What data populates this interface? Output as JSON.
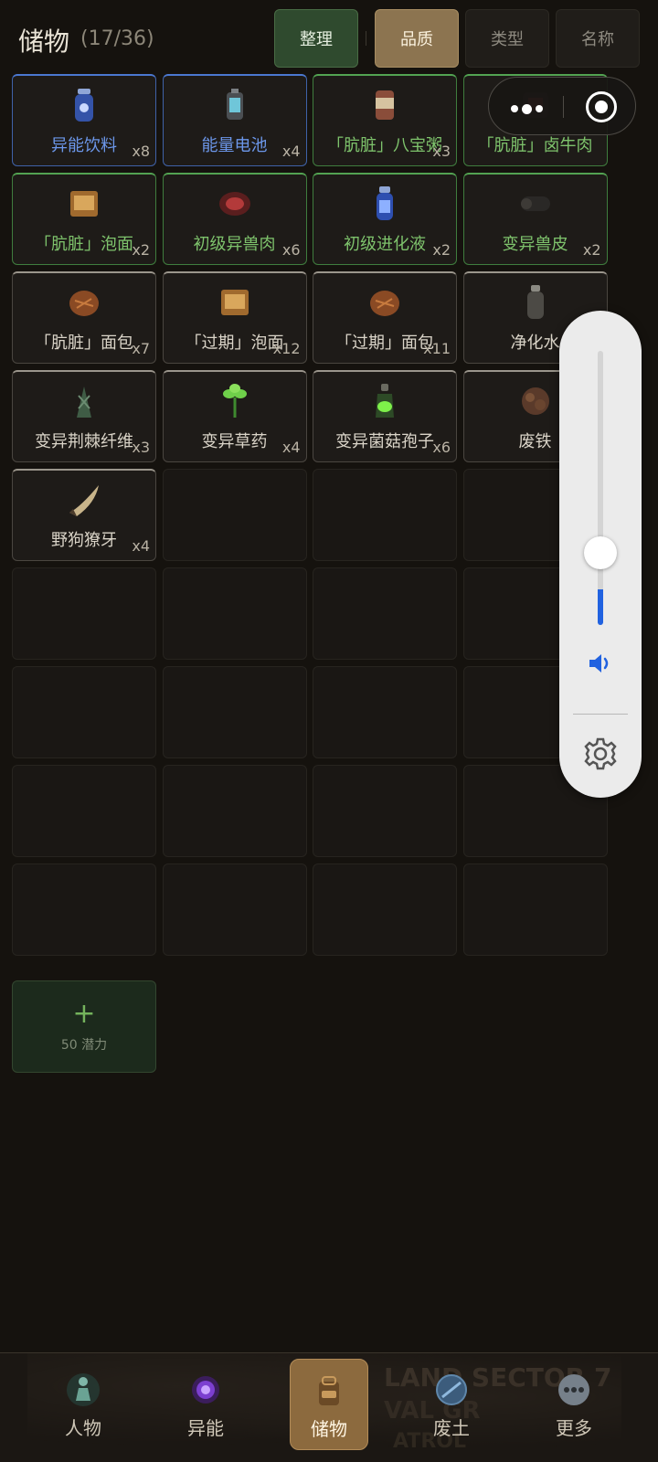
{
  "header": {
    "title": "储物",
    "count": "(17/36)",
    "organize_button": "整理",
    "sort_tabs": [
      "品质",
      "类型",
      "名称"
    ],
    "active_sort": "品质"
  },
  "items": [
    {
      "name": "异能饮料",
      "qty": "x8",
      "rarity": "blue",
      "icon": "drink-bottle-icon"
    },
    {
      "name": "能量电池",
      "qty": "x4",
      "rarity": "blue",
      "icon": "battery-icon"
    },
    {
      "name": "「肮脏」八宝粥",
      "qty": "x3",
      "rarity": "green",
      "icon": "can-icon"
    },
    {
      "name": "「肮脏」卤牛肉",
      "qty": "",
      "rarity": "green",
      "icon": "meat-can-icon"
    },
    {
      "name": "「肮脏」泡面",
      "qty": "x2",
      "rarity": "green",
      "icon": "noodle-pack-icon"
    },
    {
      "name": "初级异兽肉",
      "qty": "x6",
      "rarity": "green",
      "icon": "beast-meat-icon"
    },
    {
      "name": "初级进化液",
      "qty": "x2",
      "rarity": "green",
      "icon": "evolution-liquid-icon"
    },
    {
      "name": "变异兽皮",
      "qty": "x2",
      "rarity": "green",
      "icon": "hide-roll-icon"
    },
    {
      "name": "「肮脏」面包",
      "qty": "x7",
      "rarity": "white",
      "icon": "bread-icon"
    },
    {
      "name": "「过期」泡面",
      "qty": "x12",
      "rarity": "white",
      "icon": "noodle-pack-icon"
    },
    {
      "name": "「过期」面包",
      "qty": "x11",
      "rarity": "white",
      "icon": "bread-icon"
    },
    {
      "name": "净化水",
      "qty": "",
      "rarity": "white",
      "icon": "water-bottle-icon"
    },
    {
      "name": "变异荆棘纤维",
      "qty": "x3",
      "rarity": "white",
      "icon": "thorn-fiber-icon"
    },
    {
      "name": "变异草药",
      "qty": "x4",
      "rarity": "white",
      "icon": "herb-icon"
    },
    {
      "name": "变异菌菇孢子",
      "qty": "x6",
      "rarity": "white",
      "icon": "spore-bottle-icon"
    },
    {
      "name": "废铁",
      "qty": "",
      "rarity": "white",
      "icon": "scrap-iron-icon"
    },
    {
      "name": "野狗獠牙",
      "qty": "x4",
      "rarity": "white",
      "icon": "fang-icon"
    }
  ],
  "expand": {
    "plus": "+",
    "cost": "50 潜力"
  },
  "volume": {
    "level": 0.13
  },
  "nav": {
    "tabs": [
      {
        "label": "人物",
        "icon": "character-icon"
      },
      {
        "label": "异能",
        "icon": "ability-orb-icon"
      },
      {
        "label": "储物",
        "icon": "backpack-icon"
      },
      {
        "label": "废土",
        "icon": "wasteland-icon"
      },
      {
        "label": "更多",
        "icon": "more-icon"
      }
    ],
    "active": "储物",
    "background_text": [
      "LAND SECTOR 7",
      "VAL GR",
      "ATROL"
    ]
  },
  "colors": {
    "blue": "#4b78d0",
    "green": "#53a352",
    "white": "#9b968c",
    "accent_gold": "#8c6a3e",
    "volume_blue": "#2162e0"
  }
}
